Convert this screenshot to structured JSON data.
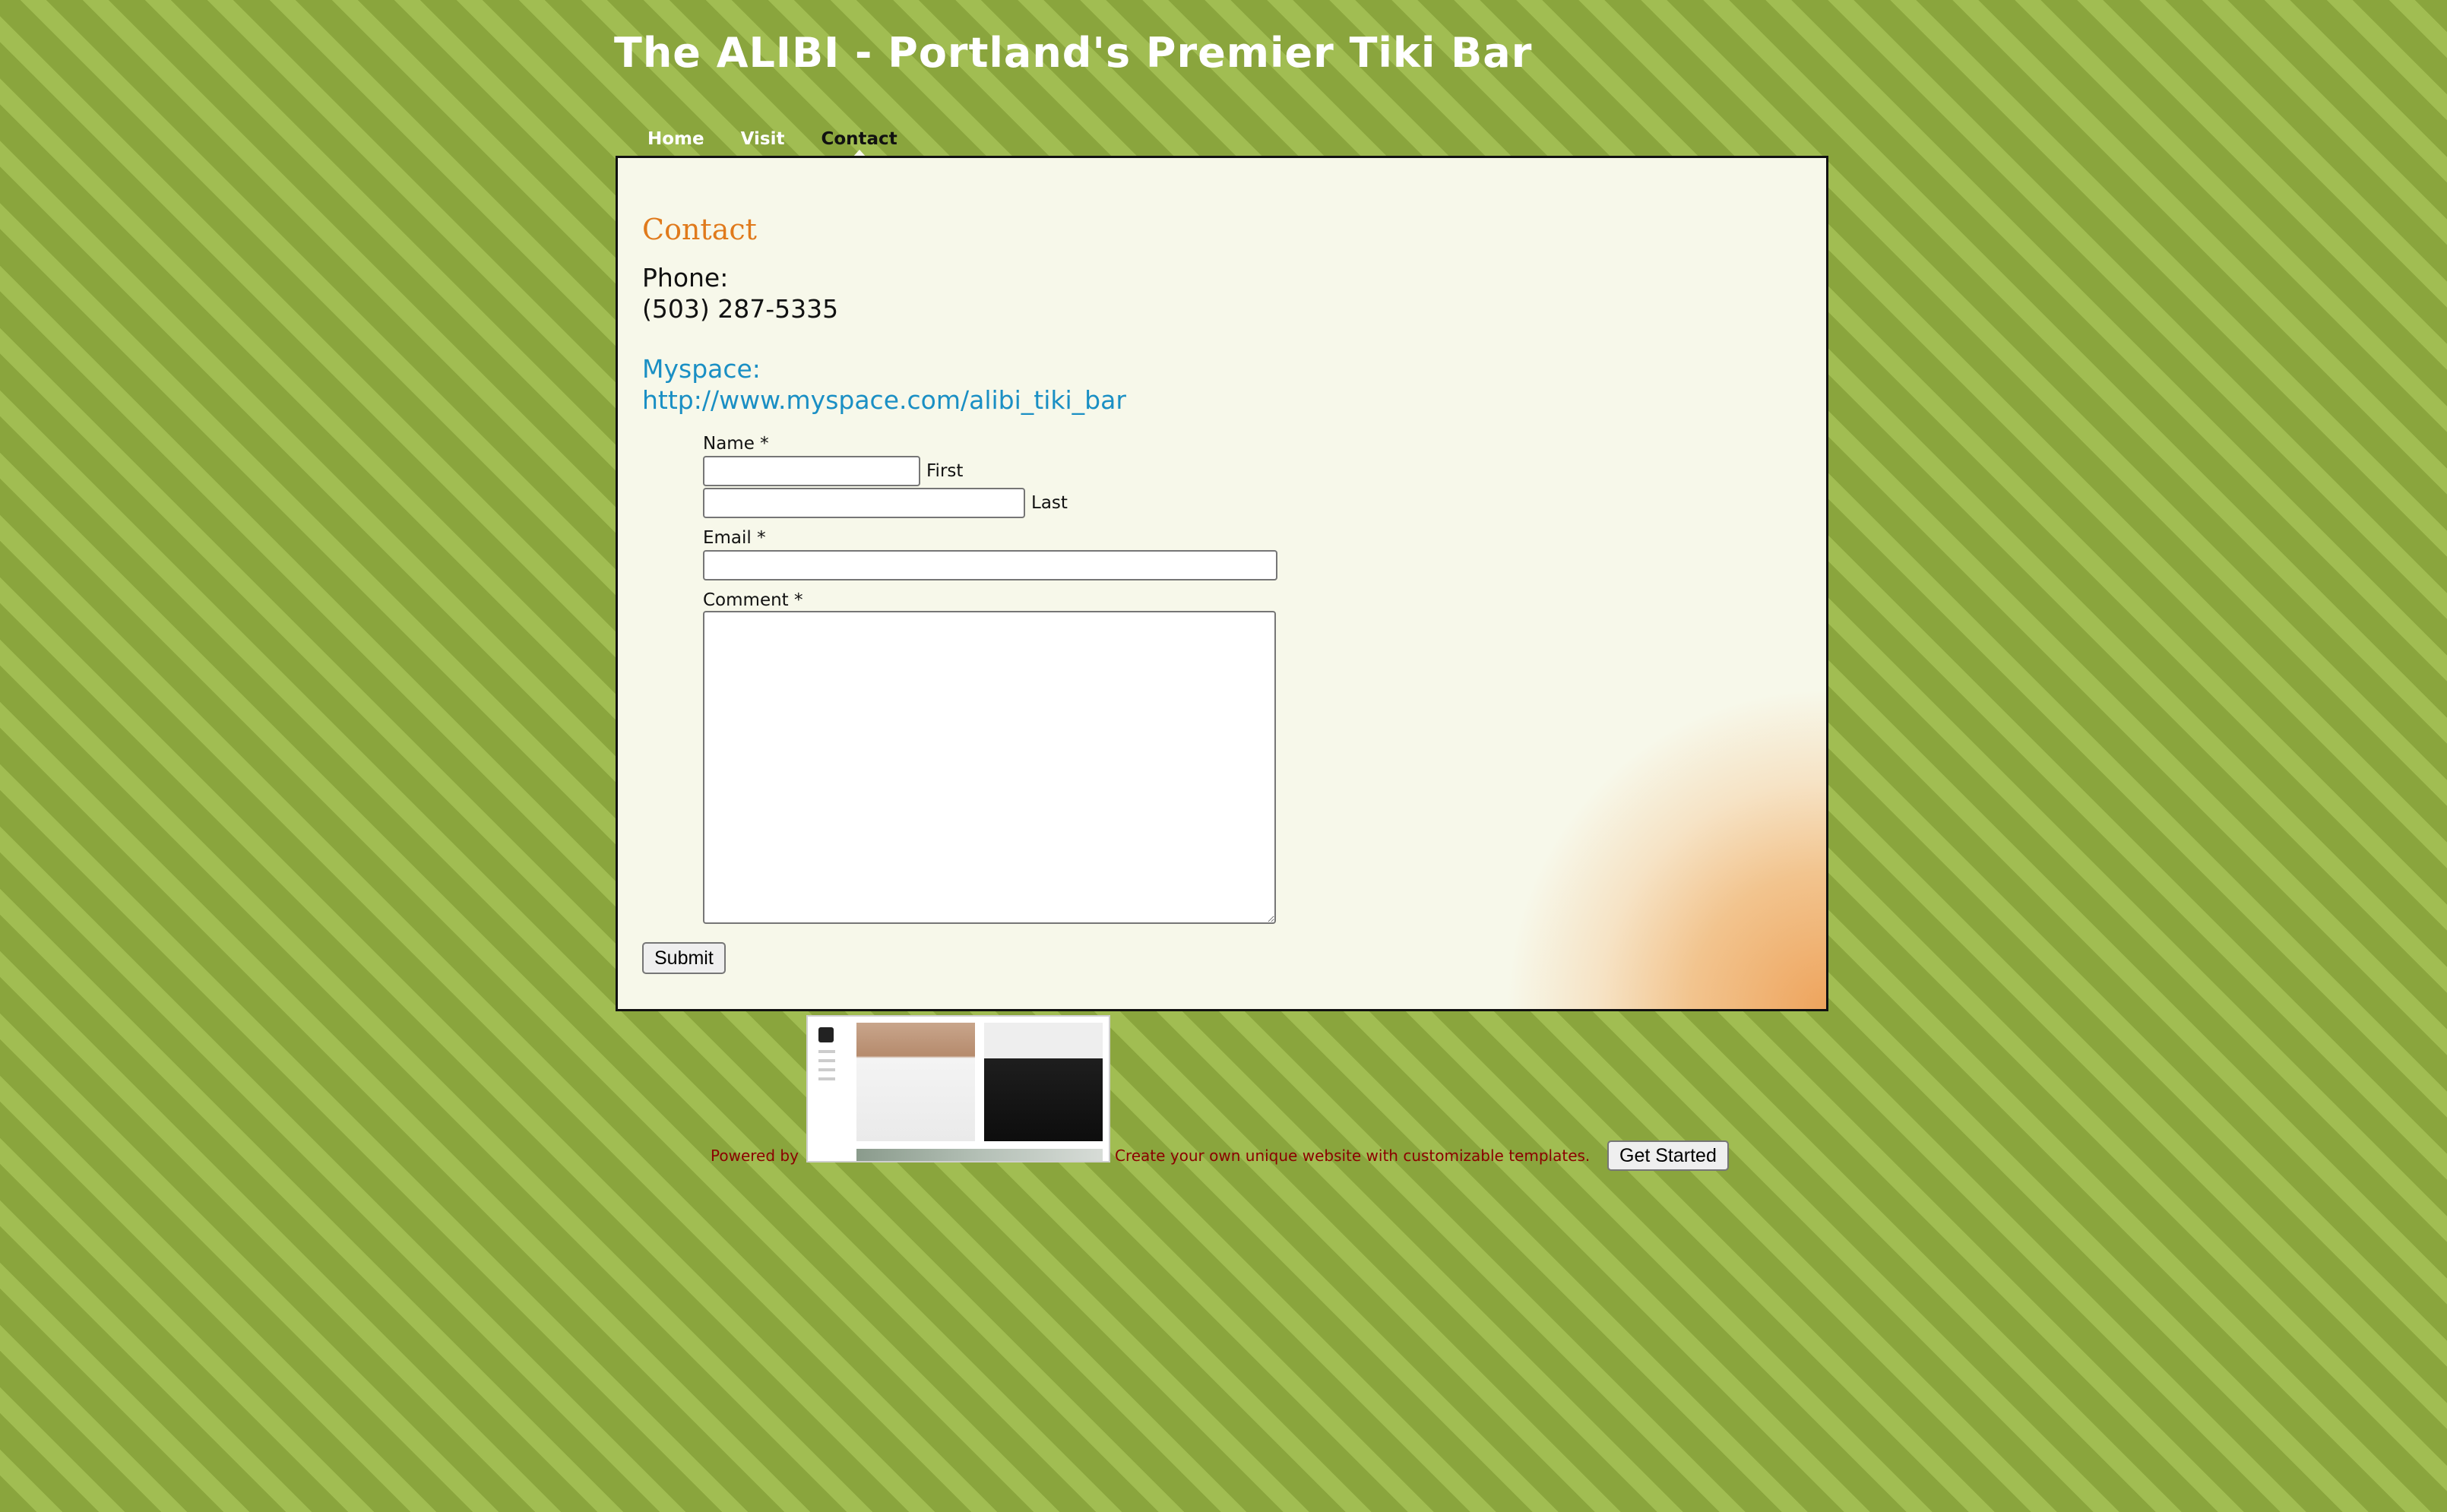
{
  "site": {
    "title": "The ALIBI - Portland's Premier Tiki Bar"
  },
  "nav": {
    "items": [
      {
        "label": "Home"
      },
      {
        "label": "Visit"
      },
      {
        "label": "Contact"
      }
    ]
  },
  "page": {
    "heading": "Contact",
    "phone_label": "Phone:",
    "phone_value": "(503) 287-5335",
    "myspace_label": "Myspace:",
    "myspace_url": "http://www.myspace.com/alibi_tiki_bar"
  },
  "form": {
    "name_label": "Name *",
    "first_label": "First",
    "last_label": "Last",
    "email_label": "Email *",
    "comment_label": "Comment *",
    "first_value": "",
    "last_value": "",
    "email_value": "",
    "comment_value": "",
    "submit_label": "Submit"
  },
  "footer": {
    "powered_by": "Powered by",
    "cta_text": "Create your own unique website with customizable templates.",
    "cta_button": "Get Started"
  },
  "colors": {
    "background": "#8aa53d",
    "heading": "#e07a1c",
    "link": "#1a8fc4",
    "footer_text": "#8b0000"
  }
}
